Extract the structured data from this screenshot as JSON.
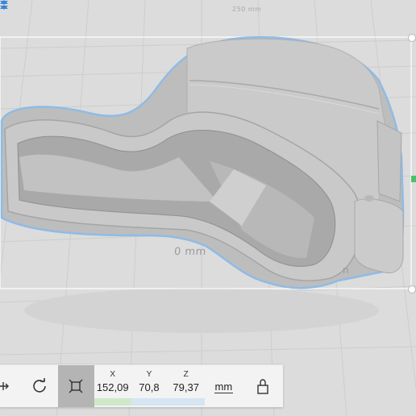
{
  "viewport": {
    "bed_top_label": "250 mm",
    "bed_front_label": "0 mm",
    "bed_front_label_end": "n",
    "colors": {
      "bed": "#dcdcdc",
      "grid": "#cfcfcf",
      "model": "#c2c2c2",
      "model_shadow": "#9e9e9e",
      "selection_outline": "#8fbbe6",
      "bounding_box": "#ffffff",
      "arrow": "#3a86d6",
      "y_axis": "#46c26a"
    }
  },
  "toolbar": {
    "move_icon": "move-icon",
    "rotate_icon": "rotate-icon",
    "scale_icon": "scale-icon",
    "x": {
      "axis": "X",
      "value": "152,09"
    },
    "y": {
      "axis": "Y",
      "value": "70,8"
    },
    "z": {
      "axis": "Z",
      "value": "79,37"
    },
    "unit": "mm",
    "lock_icon": "lock-icon"
  }
}
